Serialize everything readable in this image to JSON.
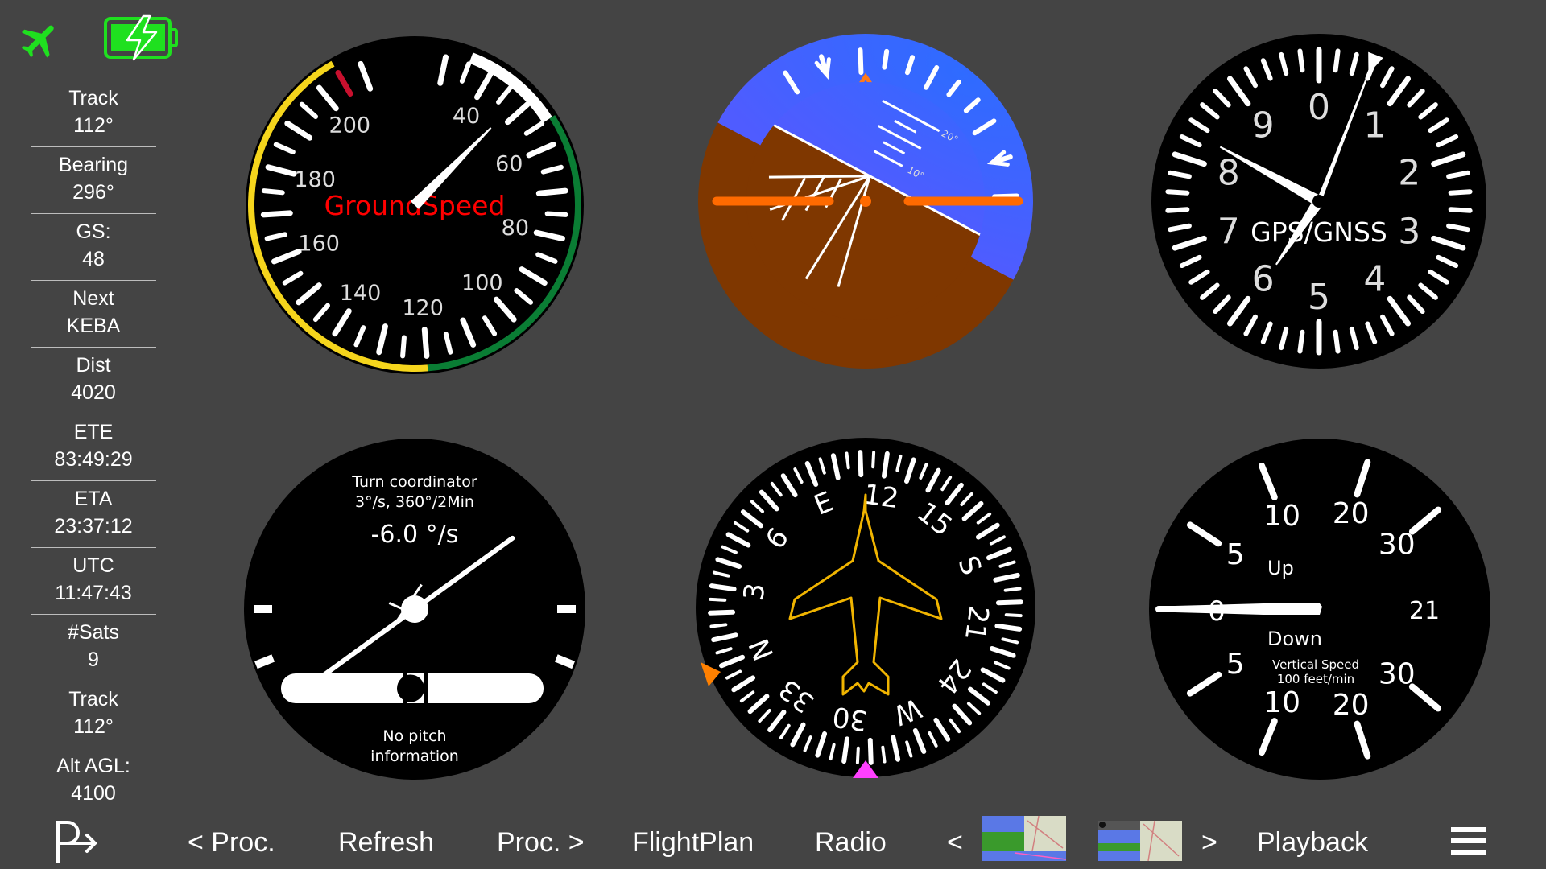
{
  "status": {
    "plane_icon": "airplane-icon",
    "battery_icon": "battery-charging-icon",
    "accent_color": "#1fe01f"
  },
  "sidebar": {
    "items": [
      {
        "label": "Track",
        "value": "112°"
      },
      {
        "label": "Bearing",
        "value": "296°"
      },
      {
        "label": "GS:",
        "value": "48"
      },
      {
        "label": "Next",
        "value": "KEBA"
      },
      {
        "label": "Dist",
        "value": "4020"
      },
      {
        "label": "ETE",
        "value": "83:49:29"
      },
      {
        "label": "ETA",
        "value": "23:37:12"
      },
      {
        "label": "UTC",
        "value": "11:47:43"
      },
      {
        "label": "#Sats",
        "value": "9"
      },
      {
        "label": "Track",
        "value": "112°"
      },
      {
        "label": "Alt AGL:",
        "value": "4100"
      }
    ]
  },
  "airspeed": {
    "title": "GroundSpeed",
    "value": 48,
    "tick_labels": [
      "40",
      "60",
      "80",
      "100",
      "120",
      "140",
      "160",
      "180",
      "200"
    ],
    "title_color": "#ff0000",
    "arc_colors": {
      "white": "#ffffff",
      "green": "#0a7d34",
      "yellow": "#f5d51c",
      "red": "#c8102e"
    }
  },
  "attitude": {
    "pitch_labels": [
      "20°",
      "10°"
    ],
    "bank_deg": -28,
    "sky_color": "#3d6cff",
    "ground_color": "#7f3700",
    "bar_color": "#ff6a00"
  },
  "clock": {
    "title": "GPS/GNSS",
    "numbers": [
      "0",
      "1",
      "2",
      "3",
      "4",
      "5",
      "6",
      "7",
      "8",
      "9"
    ],
    "hand_long_value": 1.2,
    "hand_hour_value": 8.3,
    "hand_short_value": 6.5
  },
  "turn": {
    "title": "Turn coordinator",
    "subtitle": "3°/s, 360°/2Min",
    "rate_text": "-6.0 °/s",
    "rate_value": -6.0,
    "footer_line1": "No pitch",
    "footer_line2": "information"
  },
  "heading": {
    "heading_deg": 112,
    "cardinals": {
      "0": "N",
      "90": "E",
      "180": "S",
      "270": "W"
    },
    "numbers": {
      "30": "3",
      "60": "6",
      "120": "12",
      "150": "15",
      "210": "21",
      "240": "24",
      "300": "30",
      "330": "33"
    },
    "bug_orange_color": "#ff8000",
    "bug_magenta_color": "#ff40ff",
    "plane_color": "#f0b400"
  },
  "vsi": {
    "up_label": "Up",
    "down_label": "Down",
    "caption1": "Vertical Speed",
    "caption2": "100 feet/min",
    "zero_label": "0",
    "labels_up": [
      "5",
      "10",
      "20",
      "30"
    ],
    "labels_down": [
      "5",
      "10",
      "20",
      "30"
    ],
    "right_label": "21",
    "value": 0
  },
  "bottom": {
    "proc_prev": "< Proc.",
    "refresh": "Refresh",
    "proc_next": "Proc. >",
    "flightplan": "FlightPlan",
    "radio": "Radio",
    "prev": "<",
    "next": ">",
    "playback": "Playback",
    "menu_icon": "hamburger-menu-icon",
    "pin_icon": "procedure-arrow-icon"
  }
}
